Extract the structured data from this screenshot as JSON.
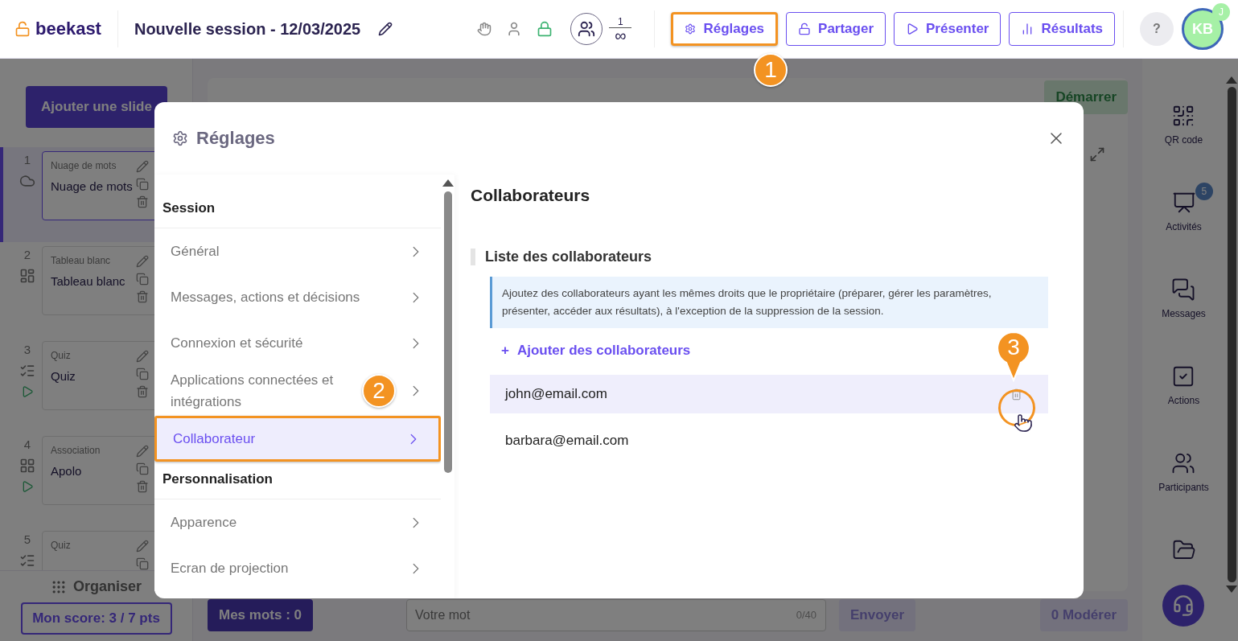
{
  "header": {
    "logo": "beekast",
    "title": "Nouvelle session - 12/03/2025",
    "participants": {
      "count": "1",
      "limit": "∞"
    },
    "actions": [
      {
        "label": "Réglages",
        "kind": "settings",
        "highlighted": true
      },
      {
        "label": "Partager",
        "kind": "share",
        "highlighted": false
      },
      {
        "label": "Présenter",
        "kind": "present",
        "highlighted": false
      },
      {
        "label": "Résultats",
        "kind": "results",
        "highlighted": false
      }
    ],
    "help": "?",
    "avatar": {
      "initials": "KB",
      "badge": "J"
    }
  },
  "sidebar": {
    "add_button": "Ajouter une slide",
    "slides": [
      {
        "number": "1",
        "type": "Nuage de mots",
        "title": "Nuage de mots",
        "kind": "cloud",
        "selected": true,
        "playable": false
      },
      {
        "number": "2",
        "type": "Tableau blanc",
        "title": "Tableau blanc",
        "kind": "board",
        "selected": false,
        "playable": false
      },
      {
        "number": "3",
        "type": "Quiz",
        "title": "Quiz",
        "kind": "quiz",
        "selected": false,
        "playable": true
      },
      {
        "number": "4",
        "type": "Association",
        "title": "Apolo",
        "kind": "association",
        "selected": false,
        "playable": true
      },
      {
        "number": "5",
        "type": "Quiz",
        "kind": "quiz",
        "selected": false,
        "playable": false
      }
    ],
    "organise": "Organiser",
    "score": "Mon score: 3 / 7 pts"
  },
  "stage": {
    "start": "Démarrer",
    "my_words": "Mes mots : 0",
    "word_field": {
      "placeholder": "Votre mot",
      "counter": "0/40"
    },
    "send": "Envoyer",
    "moderate": "0 Modérer"
  },
  "rail": {
    "items": [
      {
        "label": "QR code",
        "kind": "qr"
      },
      {
        "label": "Activités",
        "kind": "activities",
        "badge": "5"
      },
      {
        "label": "Messages",
        "kind": "messages"
      },
      {
        "label": "Actions",
        "kind": "actions"
      },
      {
        "label": "Participants",
        "kind": "participants"
      },
      {
        "kind": "folder"
      }
    ]
  },
  "modal": {
    "title": "Réglages",
    "nav": [
      {
        "title": "Session",
        "items": [
          {
            "label": "Général",
            "selected": false,
            "highlighted": false
          },
          {
            "label": "Messages, actions et décisions",
            "selected": false,
            "highlighted": false
          },
          {
            "label": "Connexion et sécurité",
            "selected": false,
            "highlighted": false
          },
          {
            "label": "Applications connectées et intégrations",
            "selected": false,
            "highlighted": false
          },
          {
            "label": "Collaborateur",
            "selected": true,
            "highlighted": true
          }
        ]
      },
      {
        "title": "Personnalisation",
        "items": [
          {
            "label": "Apparence",
            "selected": false,
            "highlighted": false
          },
          {
            "label": "Ecran de projection",
            "selected": false,
            "highlighted": false
          }
        ]
      }
    ],
    "content": {
      "heading": "Collaborateurs",
      "list_title": "Liste des collaborateurs",
      "info": "Ajoutez des collaborateurs ayant les mêmes droits que le propriétaire (préparer, gérer les paramètres, présenter, accéder aux résultats), à l'exception de la suppression de la session.",
      "add_link": {
        "icon": "+",
        "label": "Ajouter des collaborateurs"
      },
      "collaborators": [
        {
          "email": "john@email.com",
          "hovered": true
        },
        {
          "email": "barbara@email.com",
          "hovered": false
        }
      ]
    }
  },
  "annotations": [
    {
      "label": "1"
    },
    {
      "label": "2"
    },
    {
      "label": "3"
    }
  ]
}
